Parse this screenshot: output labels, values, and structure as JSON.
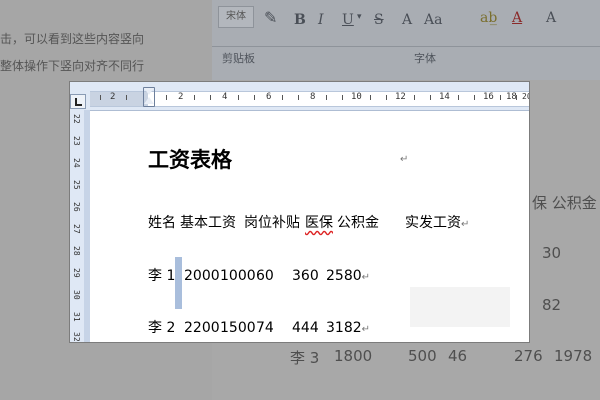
{
  "background_doc": {
    "lines": [
      "击，可以看到这些内容竖向",
      "整体操作下竖向对齐不同行"
    ],
    "ribbon": {
      "font_box": "宋体",
      "buttons": [
        "B",
        "I",
        "U",
        "S",
        "A",
        "Aa"
      ],
      "group_labels": [
        "剪贴板",
        "字体"
      ]
    },
    "right_text": {
      "header_fragment": "保  公积金",
      "v1": "30",
      "v2": "82",
      "row3": [
        "李 3",
        "1800",
        "500",
        "46",
        "276",
        "1978"
      ]
    }
  },
  "zoom": {
    "ruler_h_numbers": [
      "2",
      "2",
      "4",
      "6",
      "8",
      "10",
      "12",
      "14",
      "16",
      "18",
      "20"
    ],
    "ruler_v_numbers": [
      "22",
      "23",
      "24",
      "25",
      "26",
      "27",
      "28",
      "29",
      "30",
      "31",
      "32"
    ],
    "document": {
      "title": "工资表格",
      "header": [
        "姓名",
        "基本工资",
        "岗位补贴",
        "医保",
        "公积金",
        "实发工资"
      ],
      "rows": [
        {
          "name": "李 1",
          "base": "2000",
          "allowance": "1000",
          "insurance": "60",
          "fund": "360",
          "net": "2580"
        },
        {
          "name": "李 2",
          "base": "2200",
          "allowance": "1500",
          "insurance": "74",
          "fund": "444",
          "net": "3182"
        }
      ],
      "para_mark": "↵"
    }
  }
}
